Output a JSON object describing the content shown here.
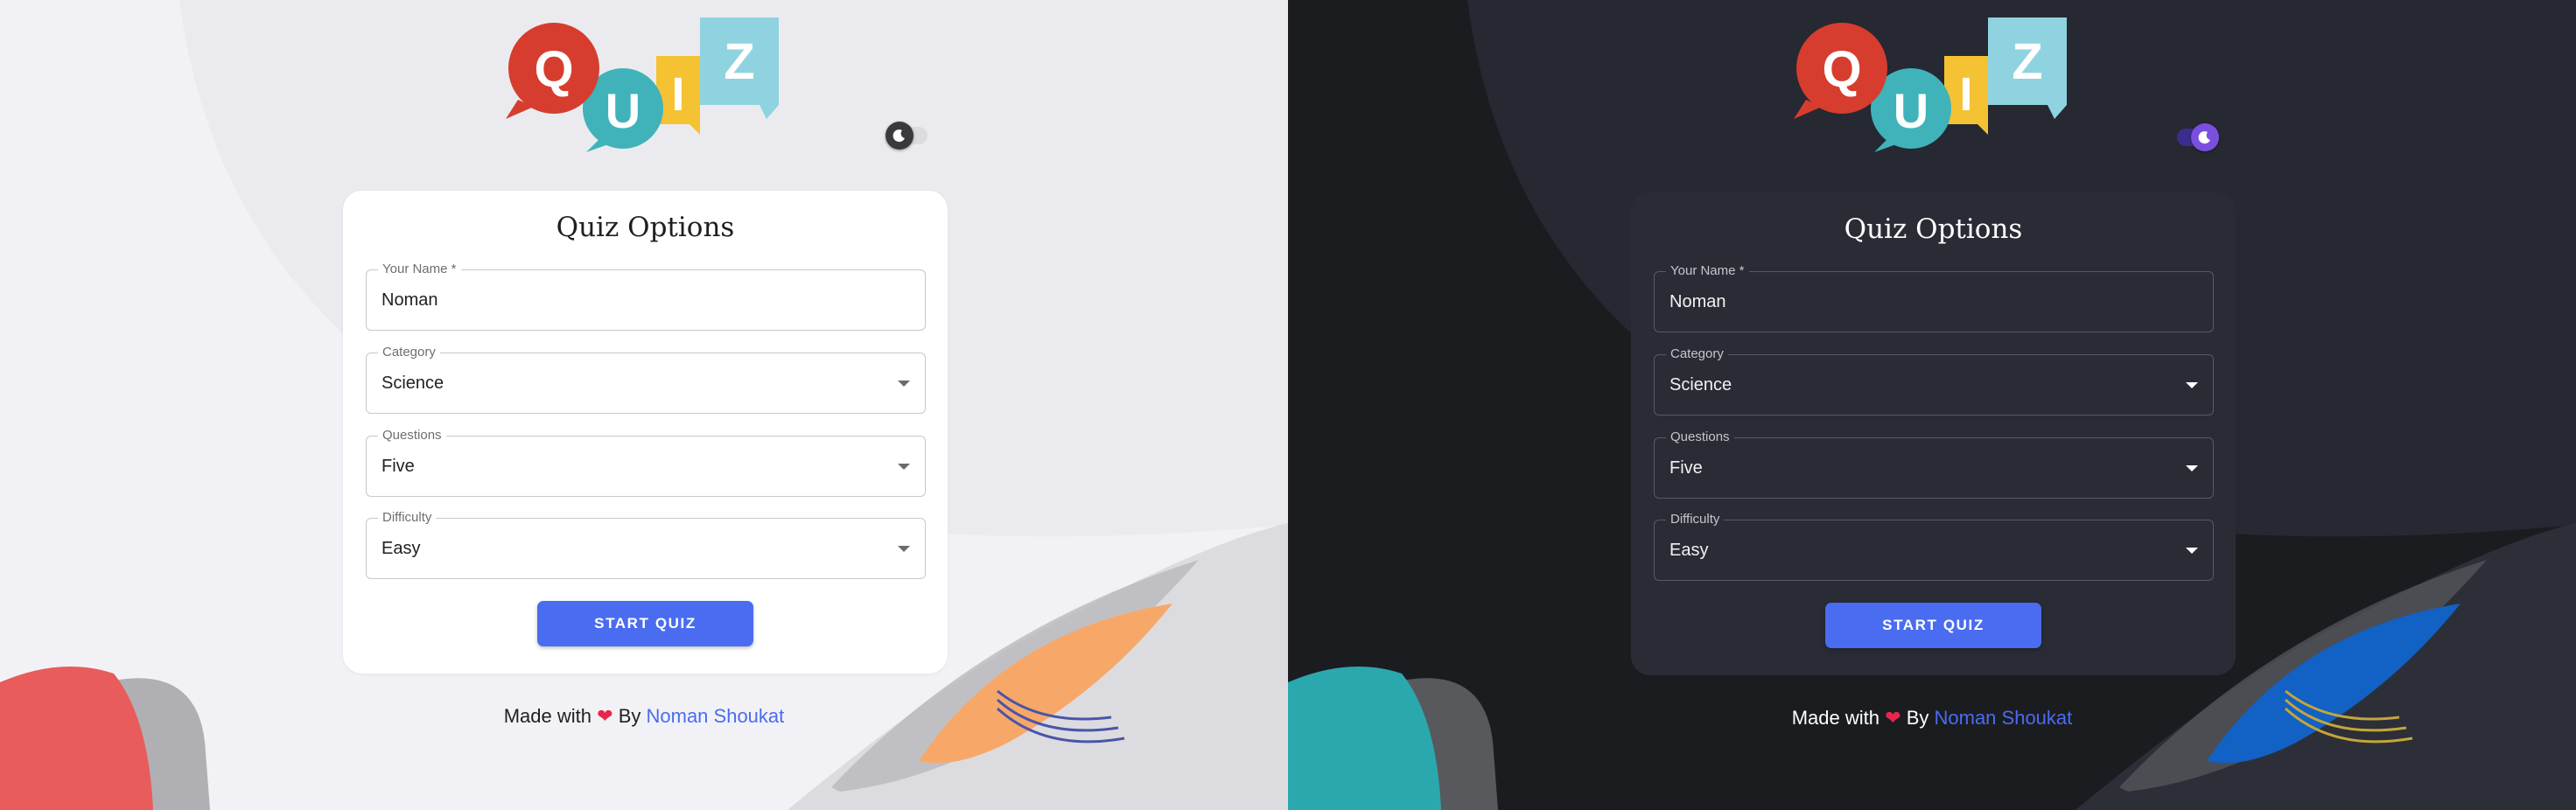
{
  "panels": {
    "light": {
      "theme": "light",
      "toggle_state": "off",
      "colors": {
        "background": "#f2f2f6",
        "card": "#ffffff",
        "accent": "#4a6cf0",
        "blob_left": "#e85c5c",
        "blob_right": "#f7a869",
        "arcs": "#4a55a8"
      }
    },
    "dark": {
      "theme": "dark",
      "toggle_state": "on",
      "colors": {
        "background": "#1b1c20",
        "card": "#292b35",
        "accent": "#4a6cf0",
        "blob_left": "#2ba8ad",
        "blob_right": "#1261c4",
        "arcs": "#c4a53a"
      }
    }
  },
  "logo": {
    "letters": [
      "Q",
      "U",
      "I",
      "Z"
    ]
  },
  "icons": {
    "theme_toggle": "moon-icon",
    "dropdown": "caret-down-icon",
    "heart": "heart-icon"
  },
  "form": {
    "title": "Quiz Options",
    "fields": [
      {
        "label": "Your Name *",
        "value": "Noman"
      },
      {
        "label": "Category",
        "value": "Science"
      },
      {
        "label": "Questions",
        "value": "Five"
      },
      {
        "label": "Difficulty",
        "value": "Easy"
      }
    ],
    "start_button": "START QUIZ"
  },
  "footer": {
    "prefix": "Made with",
    "heart": "❤",
    "by": "By",
    "author": "Noman Shoukat"
  }
}
